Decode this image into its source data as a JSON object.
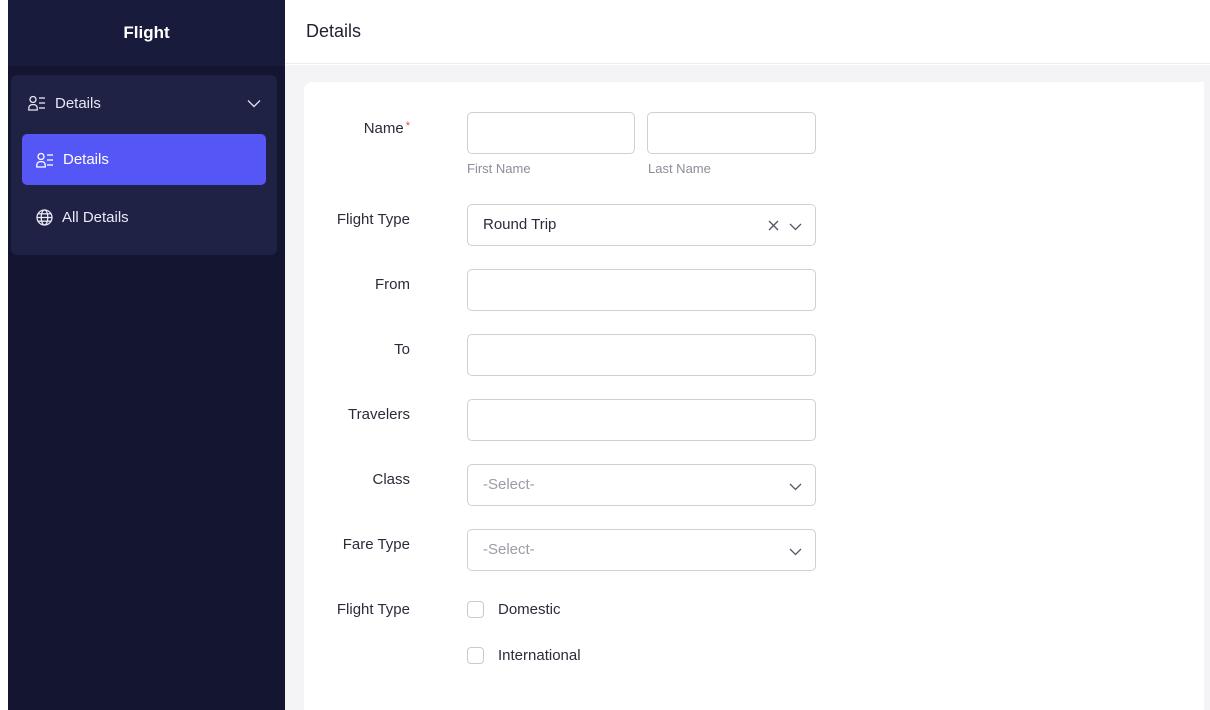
{
  "sidebar": {
    "title": "Flight",
    "group": {
      "label": "Details",
      "icon": "user-list-icon"
    },
    "items": [
      {
        "label": "Details",
        "icon": "user-list-icon",
        "active": true
      },
      {
        "label": "All Details",
        "icon": "globe-icon",
        "active": false
      }
    ]
  },
  "header": {
    "title": "Details"
  },
  "form": {
    "name": {
      "label": "Name",
      "required_mark": "*",
      "first_hint": "First Name",
      "last_hint": "Last Name",
      "first_value": "",
      "last_value": ""
    },
    "flight_type_select": {
      "label": "Flight Type",
      "value": "Round Trip"
    },
    "from": {
      "label": "From",
      "value": ""
    },
    "to": {
      "label": "To",
      "value": ""
    },
    "travelers": {
      "label": "Travelers",
      "value": ""
    },
    "class": {
      "label": "Class",
      "placeholder": "-Select-"
    },
    "fare_type": {
      "label": "Fare Type",
      "placeholder": "-Select-"
    },
    "flight_type_checks": {
      "label": "Flight Type",
      "options": [
        {
          "label": "Domestic",
          "checked": false
        },
        {
          "label": "International",
          "checked": false
        }
      ]
    }
  },
  "colors": {
    "sidebar_bg": "#141530",
    "active_item": "#5457f5",
    "required": "#e5484d"
  }
}
